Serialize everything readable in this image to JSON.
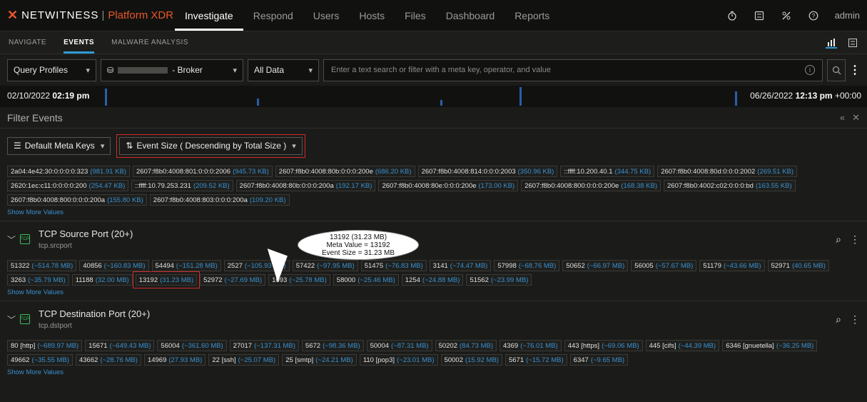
{
  "brand": {
    "name": "NETWITNESS",
    "product": "Platform XDR"
  },
  "nav": [
    "Investigate",
    "Respond",
    "Users",
    "Hosts",
    "Files",
    "Dashboard",
    "Reports"
  ],
  "user": "admin",
  "subnav": [
    "NAVIGATE",
    "EVENTS",
    "MALWARE ANALYSIS"
  ],
  "query": {
    "profiles_label": "Query Profiles",
    "broker_label": "- Broker",
    "data_label": "All Data",
    "placeholder": "Enter a text search or filter with a meta key, operator, and value"
  },
  "timeline": {
    "start_date": "02/10/2022",
    "start_time": "02:19 pm",
    "end_date": "06/26/2022",
    "end_time": "12:13 pm",
    "end_tz": "+00:00"
  },
  "filter_events": {
    "title": "Filter Events",
    "meta_keys_label": "Default Meta Keys",
    "sort_label": "Event Size ( Descending by Total Size )"
  },
  "ipv6_values": [
    {
      "v": "2a04:4e42:30:0:0:0:0:323",
      "s": "(981.91 KB)"
    },
    {
      "v": "2607:f8b0:4008:801:0:0:0:2006",
      "s": "(945.73 KB)"
    },
    {
      "v": "2607:f8b0:4008:80b:0:0:0:200e",
      "s": "(686.20 KB)"
    },
    {
      "v": "2607:f8b0:4008:814:0:0:0:2003",
      "s": "(350.96 KB)"
    },
    {
      "v": "::ffff:10.200.40.1",
      "s": "(344.75 KB)"
    },
    {
      "v": "2607:f8b0:4008:80d:0:0:0:2002",
      "s": "(269.51 KB)"
    },
    {
      "v": "2620:1ec:c11:0:0:0:0:200",
      "s": "(254.47 KB)"
    },
    {
      "v": "::ffff:10.79.253.231",
      "s": "(209.52 KB)"
    },
    {
      "v": "2607:f8b0:4008:80b:0:0:0:200a",
      "s": "(192.17 KB)"
    },
    {
      "v": "2607:f8b0:4008:80e:0:0:0:200e",
      "s": "(173.00 KB)"
    },
    {
      "v": "2607:f8b0:4008:800:0:0:0:200e",
      "s": "(168.38 KB)"
    },
    {
      "v": "2607:f8b0:4002:c02:0:0:0:bd",
      "s": "(163.55 KB)"
    },
    {
      "v": "2607:f8b0:4008:800:0:0:0:200a",
      "s": "(155.80 KB)"
    },
    {
      "v": "2607:f8b0:4008:803:0:0:0:200a",
      "s": "(109.20 KB)"
    }
  ],
  "show_more": "Show More Values",
  "tcp_src": {
    "title": "TCP Source Port (20+)",
    "key": "tcp.srcport",
    "values": [
      {
        "v": "51322",
        "s": "(~514.78 MB)"
      },
      {
        "v": "40856",
        "s": "(~160.83 MB)"
      },
      {
        "v": "54494",
        "s": "(~151.28 MB)"
      },
      {
        "v": "2527",
        "s": "(~105.93 MB)"
      },
      {
        "v": "57422",
        "s": "(~97.95 MB)"
      },
      {
        "v": "51475",
        "s": "(~76.83 MB)"
      },
      {
        "v": "3141",
        "s": "(~74.47 MB)"
      },
      {
        "v": "57998",
        "s": "(~68.76 MB)"
      },
      {
        "v": "50652",
        "s": "(~66.97 MB)"
      },
      {
        "v": "56005",
        "s": "(~57.67 MB)"
      },
      {
        "v": "51179",
        "s": "(~43.66 MB)"
      },
      {
        "v": "52971",
        "s": "(40.65 MB)"
      },
      {
        "v": "3263",
        "s": "(~35.79 MB)"
      },
      {
        "v": "11188",
        "s": "(32.00 MB)"
      },
      {
        "v": "13192",
        "s": "(31.23 MB)"
      },
      {
        "v": "52972",
        "s": "(~27.69 MB)"
      },
      {
        "v": "1093",
        "s": "(~25.78 MB)"
      },
      {
        "v": "58000",
        "s": "(~25.46 MB)"
      },
      {
        "v": "1254",
        "s": "(~24.88 MB)"
      },
      {
        "v": "51562",
        "s": "(~23.99 MB)"
      }
    ]
  },
  "callout": {
    "line1": "13192 (31.23 MB)",
    "line2": "Meta Value = 13192",
    "line3": "Event Size = 31.23 MB"
  },
  "tcp_dst": {
    "title": "TCP Destination Port (20+)",
    "key": "tcp.dstport",
    "values": [
      {
        "v": "80 [http]",
        "s": "(~689.97 MB)"
      },
      {
        "v": "15671",
        "s": "(~649.43 MB)"
      },
      {
        "v": "56004",
        "s": "(~361.60 MB)"
      },
      {
        "v": "27017",
        "s": "(~137.31 MB)"
      },
      {
        "v": "5672",
        "s": "(~98.36 MB)"
      },
      {
        "v": "50004",
        "s": "(~87.31 MB)"
      },
      {
        "v": "50202",
        "s": "(84.73 MB)"
      },
      {
        "v": "4369",
        "s": "(~76.01 MB)"
      },
      {
        "v": "443 [https]",
        "s": "(~69.06 MB)"
      },
      {
        "v": "445 [cifs]",
        "s": "(~44.39 MB)"
      },
      {
        "v": "6346 [gnuetella]",
        "s": "(~36.25 MB)"
      },
      {
        "v": "49662",
        "s": "(~35.55 MB)"
      },
      {
        "v": "43662",
        "s": "(~28.76 MB)"
      },
      {
        "v": "14969",
        "s": "(27.93 MB)"
      },
      {
        "v": "22 [ssh]",
        "s": "(~25.07 MB)"
      },
      {
        "v": "25 [smtp]",
        "s": "(~24.21 MB)"
      },
      {
        "v": "110 [pop3]",
        "s": "(~23.01 MB)"
      },
      {
        "v": "50002",
        "s": "(15.92 MB)"
      },
      {
        "v": "5671",
        "s": "(~15.72 MB)"
      },
      {
        "v": "6347",
        "s": "(~9.65 MB)"
      }
    ]
  }
}
